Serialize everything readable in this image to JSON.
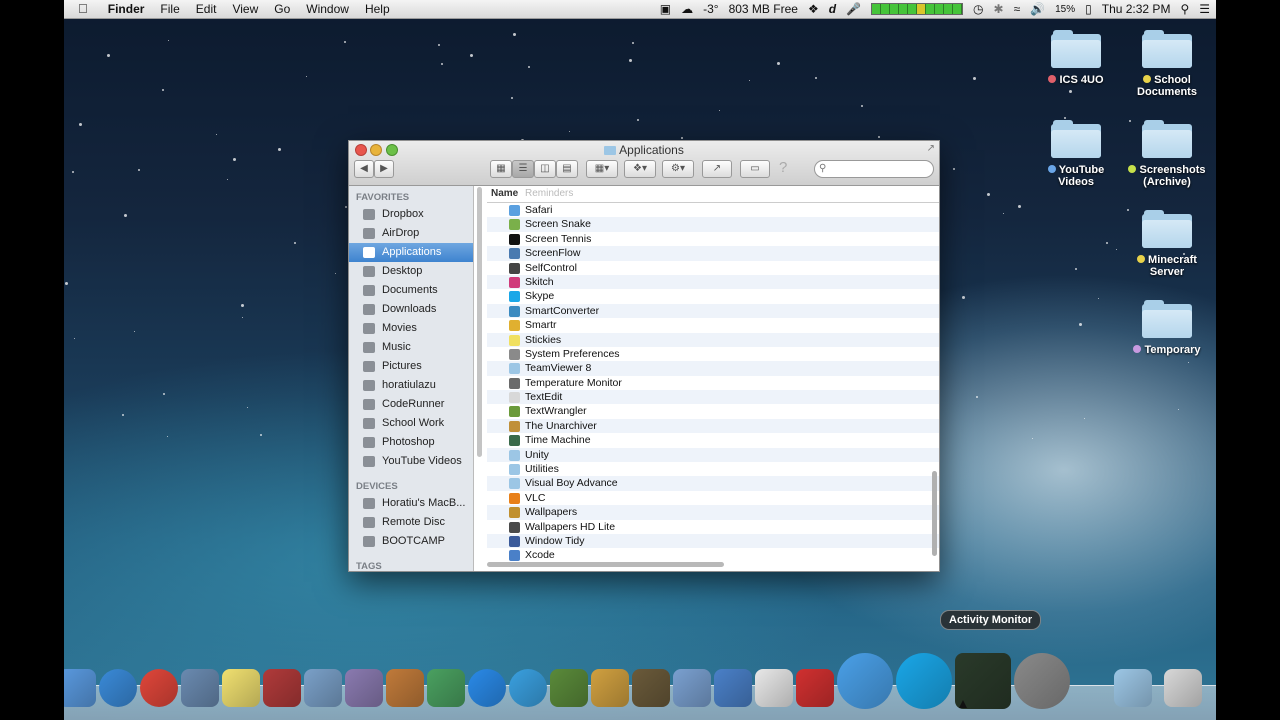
{
  "menubar": {
    "apple": "",
    "app": "Finder",
    "menus": [
      "File",
      "Edit",
      "View",
      "Go",
      "Window",
      "Help"
    ],
    "status": {
      "temperature": "-3°",
      "memory": "803 MB Free",
      "battery": "15%",
      "clock": "Thu 2:32 PM"
    }
  },
  "desktop_icons": [
    {
      "label": "ICS 4UO",
      "tag_color": "#e0606a"
    },
    {
      "label": "School Documents",
      "tag_color": "#e8d24a"
    },
    {
      "label": "YouTube Videos",
      "tag_color": "#6aa6e8"
    },
    {
      "label": "Screenshots (Archive)",
      "tag_color": "#c6e04a"
    },
    {
      "label": "Minecraft Server",
      "tag_color": "#e8d24a"
    },
    {
      "label": "Temporary",
      "tag_color": "#c89ae0"
    }
  ],
  "window": {
    "title": "Applications",
    "column_name": "Name",
    "faded_row": "Reminders",
    "sidebar": {
      "favorites_header": "FAVORITES",
      "favorites": [
        "Dropbox",
        "AirDrop",
        "Applications",
        "Desktop",
        "Documents",
        "Downloads",
        "Movies",
        "Music",
        "Pictures",
        "horatiulazu",
        "CodeRunner",
        "School Work",
        "Photoshop",
        "YouTube Videos"
      ],
      "selected": "Applications",
      "devices_header": "DEVICES",
      "devices": [
        "Horatiu's MacB...",
        "Remote Disc",
        "BOOTCAMP"
      ],
      "tags_header": "TAGS"
    },
    "files": [
      {
        "name": "Safari",
        "icon": "compass-icon",
        "color": "#5aa0e0"
      },
      {
        "name": "Screen Snake",
        "icon": "snake-icon",
        "color": "#7ab04a"
      },
      {
        "name": "Screen Tennis",
        "icon": "tennis-icon",
        "color": "#111111"
      },
      {
        "name": "ScreenFlow",
        "icon": "screenflow-icon",
        "color": "#4a7ab0"
      },
      {
        "name": "SelfControl",
        "icon": "skull-icon",
        "color": "#444444"
      },
      {
        "name": "Skitch",
        "icon": "heart-icon",
        "color": "#d03a7a"
      },
      {
        "name": "Skype",
        "icon": "skype-icon",
        "color": "#1aa7e8"
      },
      {
        "name": "SmartConverter",
        "icon": "converter-icon",
        "color": "#3a8ac0"
      },
      {
        "name": "Smartr",
        "icon": "smartr-icon",
        "color": "#e0b030"
      },
      {
        "name": "Stickies",
        "icon": "stickies-icon",
        "color": "#f0e060"
      },
      {
        "name": "System Preferences",
        "icon": "gear-icon",
        "color": "#8a8a8a"
      },
      {
        "name": "TeamViewer 8",
        "icon": "folder-icon",
        "color": "#9cc6e5"
      },
      {
        "name": "Temperature Monitor",
        "icon": "thermometer-icon",
        "color": "#6a6a6a"
      },
      {
        "name": "TextEdit",
        "icon": "textedit-icon",
        "color": "#d8d8d8"
      },
      {
        "name": "TextWrangler",
        "icon": "textwrangler-icon",
        "color": "#6a9a3a"
      },
      {
        "name": "The Unarchiver",
        "icon": "unarchiver-icon",
        "color": "#c0903a"
      },
      {
        "name": "Time Machine",
        "icon": "time-machine-icon",
        "color": "#3a6a4a"
      },
      {
        "name": "Unity",
        "icon": "folder-icon",
        "color": "#9cc6e5"
      },
      {
        "name": "Utilities",
        "icon": "folder-icon",
        "color": "#9cc6e5"
      },
      {
        "name": "Visual Boy Advance",
        "icon": "folder-icon",
        "color": "#9cc6e5"
      },
      {
        "name": "VLC",
        "icon": "vlc-cone-icon",
        "color": "#e8801a"
      },
      {
        "name": "Wallpapers",
        "icon": "wallpapers-icon",
        "color": "#c09030"
      },
      {
        "name": "Wallpapers HD Lite",
        "icon": "wallpapers-hd-icon",
        "color": "#4a4a4a"
      },
      {
        "name": "Window Tidy",
        "icon": "window-tidy-icon",
        "color": "#3a5a9a"
      },
      {
        "name": "Xcode",
        "icon": "xcode-icon",
        "color": "#4a80c8"
      }
    ]
  },
  "dock": {
    "tooltip": "Activity Monitor",
    "apps": [
      {
        "icon": "finder-icon",
        "color": "#5a9ae0"
      },
      {
        "icon": "safari-icon",
        "color": "#3a8ad8"
      },
      {
        "icon": "chrome-icon",
        "color": "#e0463a"
      },
      {
        "icon": "preview-icon",
        "color": "#6a8ab0"
      },
      {
        "icon": "stickies-icon",
        "color": "#f0e070"
      },
      {
        "icon": "dictionary-icon",
        "color": "#b03a3a"
      },
      {
        "icon": "iphoto-icon",
        "color": "#7aa0c8"
      },
      {
        "icon": "script-editor-icon",
        "color": "#8a7ab0"
      },
      {
        "icon": "keynote-icon",
        "color": "#c07a3a"
      },
      {
        "icon": "numbers-icon",
        "color": "#4aa060"
      },
      {
        "icon": "app-store-icon",
        "color": "#2a8ae8"
      },
      {
        "icon": "itunes-icon",
        "color": "#3aa0e0"
      },
      {
        "icon": "minecraft-icon",
        "color": "#5a8a3a"
      },
      {
        "icon": "photo-icon",
        "color": "#d0a040"
      },
      {
        "icon": "imovie-icon",
        "color": "#6a5a3a"
      },
      {
        "icon": "documents-icon",
        "color": "#7aa0d0"
      },
      {
        "icon": "xcode-icon",
        "color": "#4a80c8"
      },
      {
        "icon": "j-icon",
        "color": "#e8e8e8"
      },
      {
        "icon": "screen-icon",
        "color": "#d03030"
      },
      {
        "icon": "messages-icon",
        "color": "#4aa0e8"
      },
      {
        "icon": "skype-icon",
        "color": "#1aa7e8"
      },
      {
        "icon": "activity-monitor-icon",
        "color": "#2a3a2a"
      },
      {
        "icon": "system-preferences-icon",
        "color": "#8a8a8a"
      },
      {
        "icon": "applications-folder-icon",
        "color": "#9cc6e5"
      },
      {
        "icon": "downloads-icon",
        "color": "#d8d8d8"
      }
    ]
  }
}
